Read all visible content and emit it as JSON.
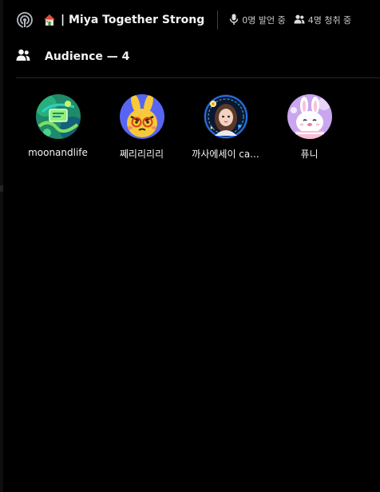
{
  "header": {
    "stage_icon": "stage-broadcast-icon",
    "house_icon": "house-emoji-icon",
    "title": "| Miya Together Strong",
    "speakers_icon": "microphone-icon",
    "speakers_text": "0명 발언 중",
    "listeners_icon": "people-icon",
    "listeners_text": "4명 청취 중"
  },
  "audience": {
    "icon": "people-icon",
    "label": "Audience — 4",
    "members": [
      {
        "name": "moonandlife",
        "avatar_icon": "green-abstract-avatar-icon"
      },
      {
        "name": "쩨리리리리",
        "avatar_icon": "yellow-bunny-avatar-icon"
      },
      {
        "name": "까사에세이 ca...",
        "avatar_icon": "girl-portrait-avatar-icon"
      },
      {
        "name": "퓨니",
        "avatar_icon": "white-bunny-avatar-icon"
      }
    ]
  },
  "colors": {
    "background": "#000000",
    "text_primary": "#f2f3f5",
    "text_secondary": "#c4c9ce",
    "divider": "#26272b"
  }
}
